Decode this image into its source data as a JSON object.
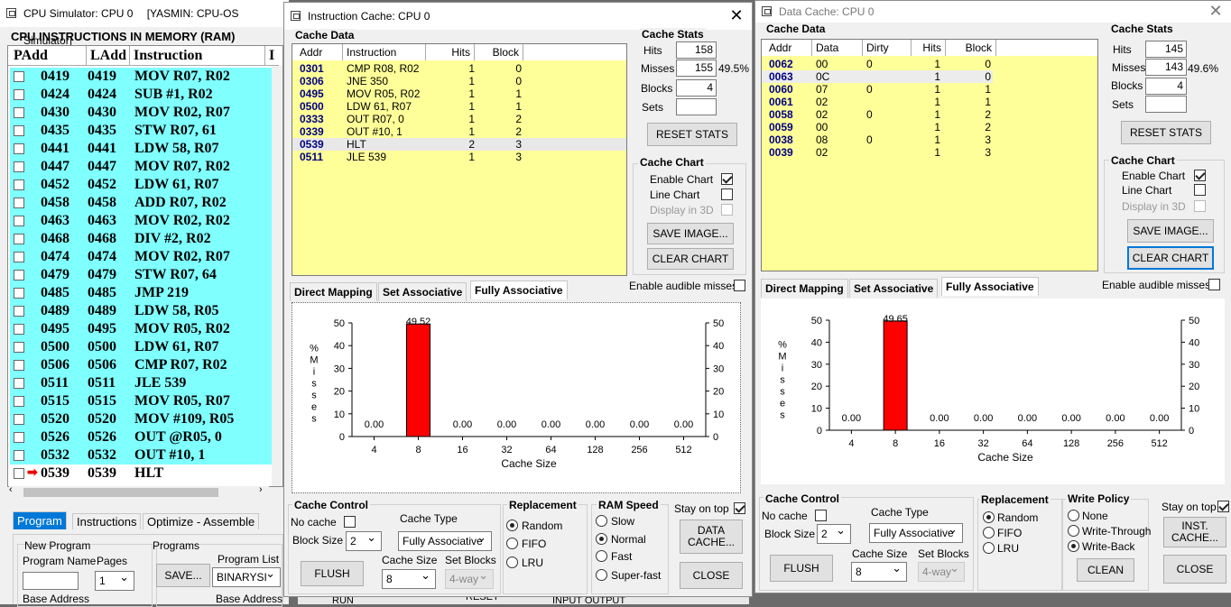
{
  "ram_window": {
    "title": "CPU Simulator: CPU 0",
    "title2": "[YASMIN: CPU-OS Simulator]",
    "heading": "CPU INSTRUCTIONS IN MEMORY (RAM)",
    "cols": [
      "PAdd",
      "LAdd",
      "Instruction",
      "I"
    ],
    "rows": [
      [
        "0419",
        "0419",
        "MOV R07, R02"
      ],
      [
        "0424",
        "0424",
        "SUB #1, R02"
      ],
      [
        "0430",
        "0430",
        "MOV R02, R07"
      ],
      [
        "0435",
        "0435",
        "STW R07, 61"
      ],
      [
        "0441",
        "0441",
        "LDW 58, R07"
      ],
      [
        "0447",
        "0447",
        "MOV R07, R02"
      ],
      [
        "0452",
        "0452",
        "LDW 61, R07"
      ],
      [
        "0458",
        "0458",
        "ADD R07, R02"
      ],
      [
        "0463",
        "0463",
        "MOV R02, R02"
      ],
      [
        "0468",
        "0468",
        "DIV #2, R02"
      ],
      [
        "0474",
        "0474",
        "MOV R02, R07"
      ],
      [
        "0479",
        "0479",
        "STW R07, 64"
      ],
      [
        "0485",
        "0485",
        "JMP 219"
      ],
      [
        "0489",
        "0489",
        "LDW 58, R05"
      ],
      [
        "0495",
        "0495",
        "MOV R05, R02"
      ],
      [
        "0500",
        "0500",
        "LDW 61, R07"
      ],
      [
        "0506",
        "0506",
        "CMP R07, R02"
      ],
      [
        "0511",
        "0511",
        "JLE 539"
      ],
      [
        "0515",
        "0515",
        "MOV R05, R07"
      ],
      [
        "0520",
        "0520",
        "MOV #109, R05"
      ],
      [
        "0526",
        "0526",
        "OUT @R05, 0"
      ],
      [
        "0532",
        "0532",
        "OUT #10, 1"
      ],
      [
        "0539",
        "0539",
        "HLT"
      ]
    ],
    "tabs": [
      "Program",
      "Instructions",
      "Optimize - Assemble"
    ],
    "new_program": "New Program",
    "program_name": "Program Name",
    "pages": "Pages",
    "pages_value": "1",
    "programs": "Programs",
    "save": "SAVE...",
    "program_list": "Program List",
    "program_list_value": "BINARYSI",
    "base_address": "Base Address",
    "base_address2": "Base Address",
    "run": "RUN",
    "reset": "RESET",
    "input_output": "INPUT OUTPUT"
  },
  "icache": {
    "title": "Instruction Cache: CPU 0",
    "cache_data_label": "Cache Data",
    "cols": [
      "Addr",
      "Instruction",
      "Hits",
      "Block"
    ],
    "rows": [
      [
        "0301",
        "CMP R08, R02",
        "1",
        "0"
      ],
      [
        "0306",
        "JNE 350",
        "1",
        "0"
      ],
      [
        "0495",
        "MOV R05, R02",
        "1",
        "1"
      ],
      [
        "0500",
        "LDW 61, R07",
        "1",
        "1"
      ],
      [
        "0333",
        "OUT R07, 0",
        "1",
        "2"
      ],
      [
        "0339",
        "OUT #10, 1",
        "1",
        "2"
      ],
      [
        "0539",
        "HLT",
        "2",
        "3"
      ],
      [
        "0511",
        "JLE 539",
        "1",
        "3"
      ]
    ],
    "stats": {
      "label": "Cache Stats",
      "hits_label": "Hits",
      "hits": "158",
      "misses_label": "Misses",
      "misses": "155",
      "pct": "49.5%",
      "blocks_label": "Blocks",
      "blocks": "4",
      "sets_label": "Sets",
      "sets": "",
      "reset": "RESET STATS"
    },
    "chart_group": {
      "label": "Cache Chart",
      "enable": "Enable Chart",
      "line": "Line Chart",
      "d3": "Display in 3D",
      "save": "SAVE IMAGE...",
      "clear": "CLEAR CHART"
    },
    "tabs": [
      "Direct Mapping",
      "Set Associative",
      "Fully Associative"
    ],
    "audible": "Enable audible misses",
    "control": {
      "label": "Cache Control",
      "no_cache": "No cache",
      "block_size": "Block Size",
      "block_size_value": "2",
      "cache_type": "Cache Type",
      "cache_type_value": "Fully Associative",
      "cache_size": "Cache Size",
      "cache_size_value": "8",
      "set_blocks": "Set Blocks",
      "set_blocks_value": "4-way",
      "flush": "FLUSH"
    },
    "replacement": {
      "label": "Replacement",
      "opts": [
        "Random",
        "FIFO",
        "LRU"
      ]
    },
    "ram_speed": {
      "label": "RAM Speed",
      "opts": [
        "Slow",
        "Normal",
        "Fast",
        "Super-fast"
      ]
    },
    "stay_on_top": "Stay on top",
    "data_cache_btn": "DATA CACHE...",
    "close": "CLOSE"
  },
  "dcache": {
    "title": "Data Cache: CPU 0",
    "cache_data_label": "Cache Data",
    "cols": [
      "Addr",
      "Data",
      "Dirty",
      "Hits",
      "Block"
    ],
    "rows": [
      [
        "0062",
        "00",
        "0",
        "1",
        "0"
      ],
      [
        "0063",
        "0C",
        "",
        "1",
        "0"
      ],
      [
        "0060",
        "07",
        "0",
        "1",
        "1"
      ],
      [
        "0061",
        "02",
        "",
        "1",
        "1"
      ],
      [
        "0058",
        "02",
        "0",
        "1",
        "2"
      ],
      [
        "0059",
        "00",
        "",
        "1",
        "2"
      ],
      [
        "0038",
        "08",
        "0",
        "1",
        "3"
      ],
      [
        "0039",
        "02",
        "",
        "1",
        "3"
      ]
    ],
    "stats": {
      "label": "Cache Stats",
      "hits_label": "Hits",
      "hits": "145",
      "misses_label": "Misses",
      "misses": "143",
      "pct": "49.6%",
      "blocks_label": "Blocks",
      "blocks": "4",
      "sets_label": "Sets",
      "sets": "",
      "reset": "RESET STATS"
    },
    "chart_group": {
      "label": "Cache Chart",
      "enable": "Enable Chart",
      "line": "Line Chart",
      "d3": "Display in 3D",
      "save": "SAVE IMAGE...",
      "clear": "CLEAR CHART"
    },
    "tabs": [
      "Direct Mapping",
      "Set Associative",
      "Fully Associative"
    ],
    "audible": "Enable audible misses",
    "control": {
      "label": "Cache Control",
      "no_cache": "No cache",
      "block_size": "Block Size",
      "block_size_value": "2",
      "cache_type": "Cache Type",
      "cache_type_value": "Fully Associative",
      "cache_size": "Cache Size",
      "cache_size_value": "8",
      "set_blocks": "Set Blocks",
      "set_blocks_value": "4-way",
      "flush": "FLUSH"
    },
    "replacement": {
      "label": "Replacement",
      "opts": [
        "Random",
        "FIFO",
        "LRU"
      ]
    },
    "write_policy": {
      "label": "Write Policy",
      "opts": [
        "None",
        "Write-Through",
        "Write-Back"
      ],
      "clean": "CLEAN"
    },
    "stay_on_top": "Stay on top",
    "inst_cache_btn": "INST. CACHE...",
    "close": "CLOSE"
  },
  "chart_data": [
    {
      "type": "bar",
      "ylabel": "% Misses",
      "xlabel": "Cache Size",
      "categories": [
        "4",
        "8",
        "16",
        "32",
        "64",
        "128",
        "256",
        "512"
      ],
      "values": [
        0.0,
        49.52,
        0.0,
        0.0,
        0.0,
        0.0,
        0.0,
        0.0
      ],
      "labels": [
        "0.00",
        "49.52",
        "0.00",
        "0.00",
        "0.00",
        "0.00",
        "0.00",
        "0.00"
      ],
      "ylim": [
        0,
        50
      ],
      "yticks": [
        "0",
        "10",
        "20",
        "30",
        "40",
        "50"
      ],
      "color": "#ff0000"
    },
    {
      "type": "bar",
      "ylabel": "% Misses",
      "xlabel": "Cache Size",
      "categories": [
        "4",
        "8",
        "16",
        "32",
        "64",
        "128",
        "256",
        "512"
      ],
      "values": [
        0.0,
        49.65,
        0.0,
        0.0,
        0.0,
        0.0,
        0.0,
        0.0
      ],
      "labels": [
        "0.00",
        "49.65",
        "0.00",
        "0.00",
        "0.00",
        "0.00",
        "0.00",
        "0.00"
      ],
      "ylim": [
        0,
        50
      ],
      "yticks": [
        "0",
        "10",
        "20",
        "30",
        "40",
        "50"
      ],
      "color": "#ff0000"
    }
  ]
}
